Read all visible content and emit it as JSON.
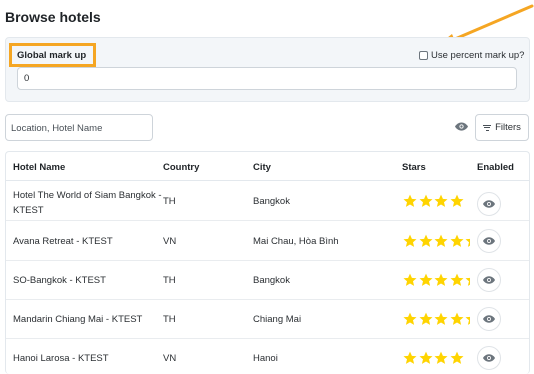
{
  "page": {
    "title": "Browse hotels"
  },
  "markup": {
    "label": "Global mark up",
    "value": "0",
    "percent_label": "Use percent mark up?",
    "percent_checked": false
  },
  "search": {
    "placeholder": "Location, Hotel Name"
  },
  "filters": {
    "label": "Filters"
  },
  "table": {
    "columns": [
      "Hotel Name",
      "Country",
      "City",
      "Stars",
      "Enabled"
    ],
    "rows": [
      {
        "name_line1": "Hotel The World of Siam Bangkok -",
        "name_line2": "KTEST",
        "country": "TH",
        "city": "Bangkok",
        "stars": 4
      },
      {
        "name_line1": "Avana Retreat - KTEST",
        "name_line2": "",
        "country": "VN",
        "city": "Mai Chau, Hòa Bình",
        "stars": 4.5
      },
      {
        "name_line1": "SO-Bangkok - KTEST",
        "name_line2": "",
        "country": "TH",
        "city": "Bangkok",
        "stars": 4.5
      },
      {
        "name_line1": "Mandarin Chiang Mai - KTEST",
        "name_line2": "",
        "country": "TH",
        "city": "Chiang Mai",
        "stars": 4.5
      },
      {
        "name_line1": "Hanoi Larosa - KTEST",
        "name_line2": "",
        "country": "VN",
        "city": "Hanoi",
        "stars": 4
      }
    ]
  },
  "colors": {
    "accent": "#f5a623",
    "star": "#ffd400",
    "icon": "#6c757d"
  },
  "icons": {
    "eye": "eye-icon",
    "filter": "filter-icon",
    "arrow": "annotation-arrow-icon"
  }
}
